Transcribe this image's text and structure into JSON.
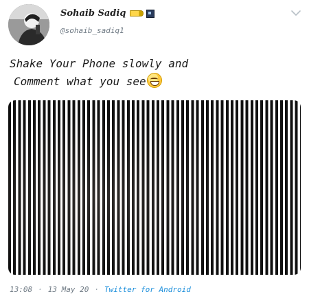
{
  "tweet": {
    "author": {
      "display_name": "Sohaib Sadiq",
      "handle": "@sohaib_sadiq1"
    },
    "text_line1": "Shake Your Phone slowly and",
    "text_line2": "Comment what you see",
    "emoji": "grinning-face-with-smiling-eyes",
    "media": {
      "type": "vertical-stripes-illusion"
    },
    "footer": {
      "time": "13:08",
      "date": "13 May 20",
      "source": "Twitter for Android"
    }
  },
  "colors": {
    "link": "#1d8fdb",
    "muted": "#6f7a84",
    "stripe_dark": "#101010"
  }
}
